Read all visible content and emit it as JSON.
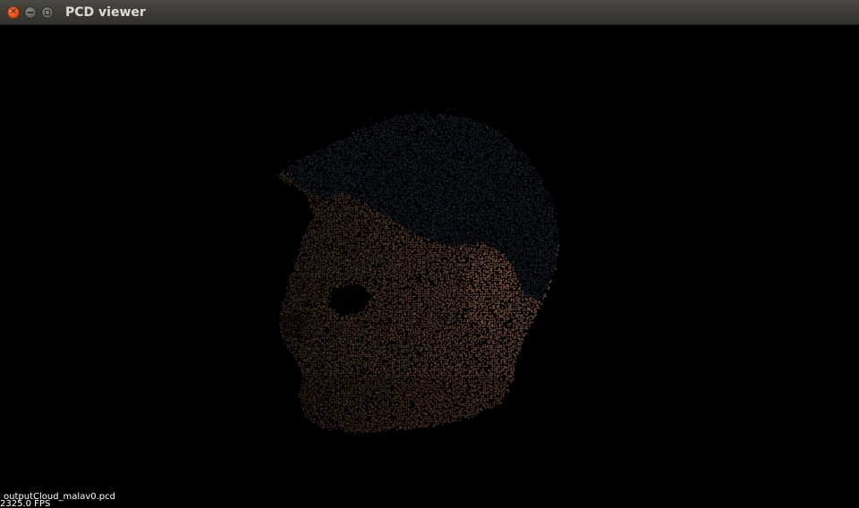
{
  "window": {
    "title": "PCD viewer",
    "controls": [
      "close",
      "minimize",
      "maximize"
    ]
  },
  "viewer": {
    "background_color": "#000000",
    "overlay": {
      "filename": "outputCloud_malav0.pcd",
      "fps": "2325.0 FPS"
    }
  },
  "colors": {
    "titlebar": "#3c3b37",
    "close_button": "#e2531e",
    "title_text": "#dfdbd2"
  },
  "icons": {
    "close": "close-icon",
    "minimize": "minimize-icon",
    "maximize": "maximize-icon"
  }
}
